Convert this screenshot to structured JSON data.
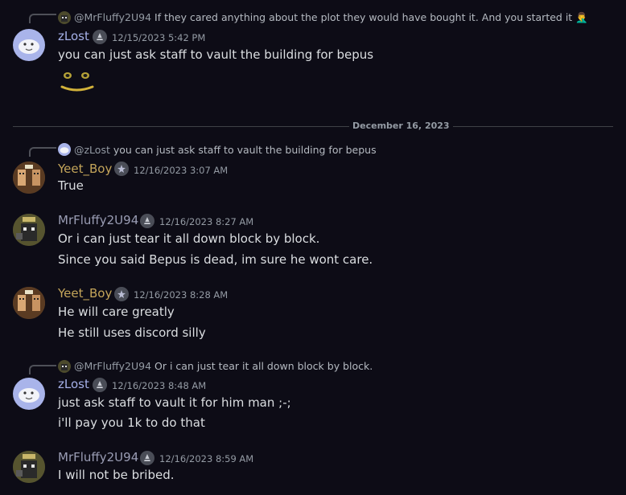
{
  "messages": [
    {
      "reply_to": {
        "mention": "@MrFluffy2U94",
        "text": "If they cared anything about the plot they would have bought it. And you started it",
        "emoji": "🤦‍♂️"
      },
      "author": "zLost",
      "timestamp": "12/15/2023 5:42 PM",
      "lines": [
        "you can just ask staff to vault the building for bepus"
      ]
    },
    {
      "reply_to": {
        "mention": "@zLost",
        "text": "you can just ask staff to vault the building for bepus"
      },
      "author": "Yeet_Boy",
      "timestamp": "12/16/2023 3:07 AM",
      "lines": [
        "True"
      ]
    },
    {
      "author": "MrFluffy2U94",
      "timestamp": "12/16/2023 8:27 AM",
      "lines": [
        "Or i can just tear it all down block by block.",
        "Since you said Bepus is dead, im sure he wont care."
      ]
    },
    {
      "author": "Yeet_Boy",
      "timestamp": "12/16/2023 8:28 AM",
      "lines": [
        "He will care greatly",
        "He still uses discord silly"
      ]
    },
    {
      "reply_to": {
        "mention": "@MrFluffy2U94",
        "text": "Or i can just tear it all down block by block."
      },
      "author": "zLost",
      "timestamp": "12/16/2023 8:48 AM",
      "lines": [
        "just ask staff to vault it for him man ;-;",
        "i'll pay you 1k to do that"
      ]
    },
    {
      "author": "MrFluffy2U94",
      "timestamp": "12/16/2023 8:59 AM",
      "lines": [
        "I will not be bribed."
      ]
    }
  ],
  "date_divider": "December 16, 2023",
  "colors": {
    "background": "#0d0c16",
    "zlost": "#a5b0e8",
    "yeet_boy": "#c4a55a",
    "mrfluffy": "#9a9db4"
  }
}
